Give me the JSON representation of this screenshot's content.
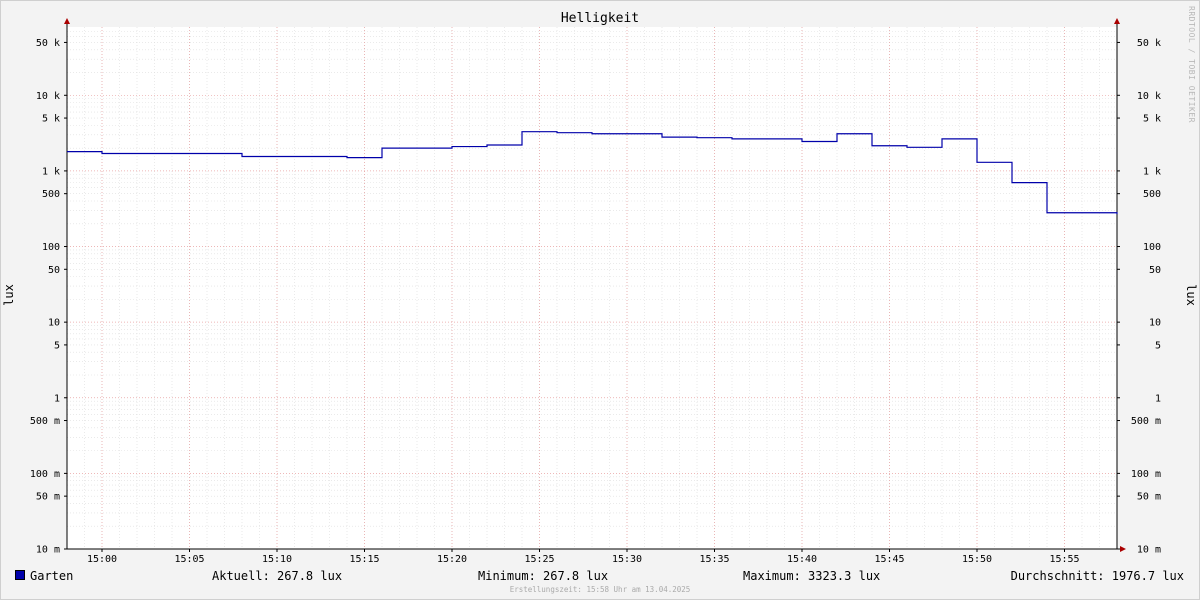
{
  "watermark": "RRDTOOL / TOBI OETIKER",
  "chart_data": {
    "type": "line",
    "title": "Helligkeit",
    "ylabel": "lux",
    "yscale": "log",
    "ylim": [
      0.01,
      80000
    ],
    "xlim": [
      "14:58",
      "15:58"
    ],
    "x_ticks": [
      "15:00",
      "15:05",
      "15:10",
      "15:15",
      "15:20",
      "15:25",
      "15:30",
      "15:35",
      "15:40",
      "15:45",
      "15:50",
      "15:55"
    ],
    "y_ticks": [
      {
        "value": 50000,
        "label": "50 k"
      },
      {
        "value": 10000,
        "label": "10 k"
      },
      {
        "value": 5000,
        "label": "5 k"
      },
      {
        "value": 1000,
        "label": "1 k"
      },
      {
        "value": 500,
        "label": "500"
      },
      {
        "value": 100,
        "label": "100"
      },
      {
        "value": 50,
        "label": "50"
      },
      {
        "value": 10,
        "label": "10"
      },
      {
        "value": 5,
        "label": "5"
      },
      {
        "value": 1,
        "label": "1"
      },
      {
        "value": 0.5,
        "label": "500 m"
      },
      {
        "value": 0.1,
        "label": "100 m"
      },
      {
        "value": 0.05,
        "label": "50 m"
      },
      {
        "value": 0.01,
        "label": "10 m"
      }
    ],
    "grid": true,
    "legend": "bottom-left",
    "color": "#0000aa",
    "series": [
      {
        "name": "Garten",
        "x": [
          "14:58",
          "15:00",
          "15:06",
          "15:08",
          "15:14",
          "15:16",
          "15:20",
          "15:22",
          "15:24",
          "15:26",
          "15:28",
          "15:32",
          "15:34",
          "15:36",
          "15:40",
          "15:42",
          "15:44",
          "15:46",
          "15:48",
          "15:50",
          "15:52",
          "15:54",
          "15:58"
        ],
        "y": [
          1800,
          1700,
          1700,
          1550,
          1500,
          2000,
          2100,
          2200,
          3300,
          3200,
          3100,
          2800,
          2750,
          2650,
          2450,
          3100,
          2150,
          2050,
          2650,
          1300,
          700,
          280,
          268
        ]
      }
    ]
  },
  "legend": {
    "series_name": "Garten",
    "current": "Aktuell: 267.8 lux",
    "minimum": "Minimum: 267.8 lux",
    "maximum": "Maximum: 3323.3 lux",
    "average": "Durchschnitt: 1976.7 lux"
  },
  "footer": "Erstellungszeit: 15:58 Uhr am 13.04.2025"
}
